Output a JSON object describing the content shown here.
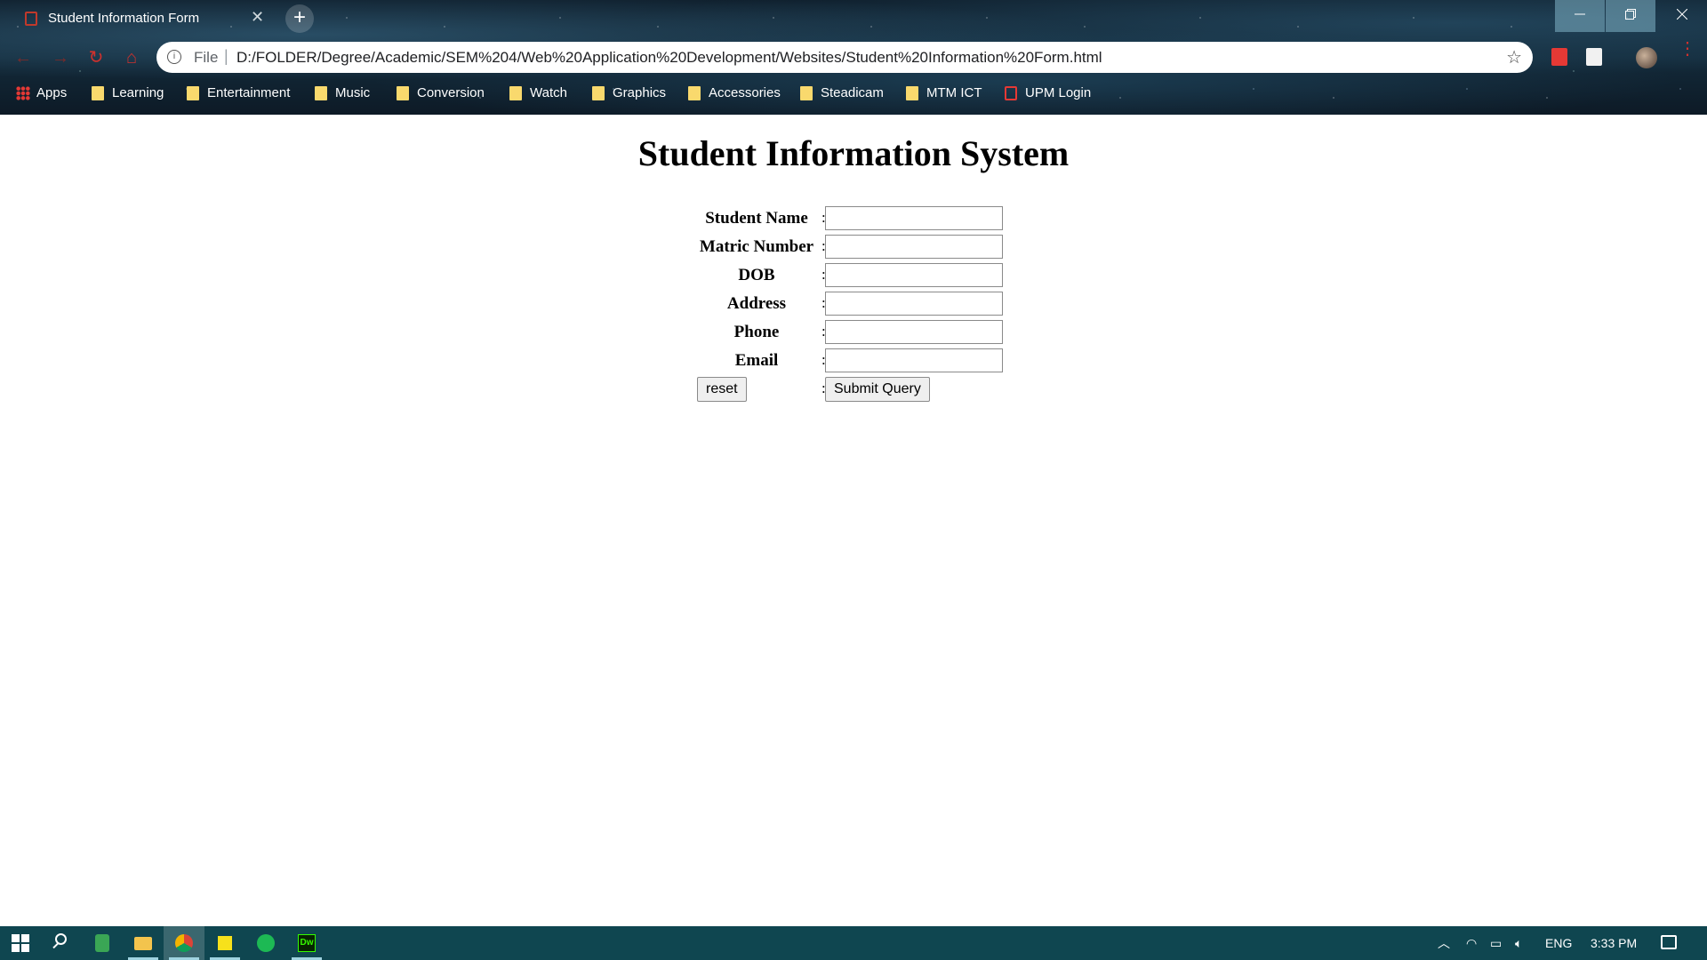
{
  "browser": {
    "tab_title": "Student Information Form",
    "new_tab_symbol": "+",
    "close_tab_symbol": "✕",
    "address_prefix": "File",
    "url": "D:/FOLDER/Degree/Academic/SEM%204/Web%20Application%20Development/Websites/Student%20Information%20Form.html",
    "bookmarks": [
      {
        "label": "Apps",
        "icon": "apps-grid-icon"
      },
      {
        "label": "Learning",
        "icon": "folder-icon"
      },
      {
        "label": "Entertainment",
        "icon": "folder-icon"
      },
      {
        "label": "Music",
        "icon": "folder-icon"
      },
      {
        "label": "Conversion",
        "icon": "folder-icon"
      },
      {
        "label": "Watch",
        "icon": "folder-icon"
      },
      {
        "label": "Graphics",
        "icon": "folder-icon"
      },
      {
        "label": "Accessories",
        "icon": "folder-icon"
      },
      {
        "label": "Steadicam",
        "icon": "folder-icon"
      },
      {
        "label": "MTM ICT",
        "icon": "folder-icon"
      },
      {
        "label": "UPM Login",
        "icon": "pdf-icon"
      }
    ]
  },
  "page": {
    "heading": "Student Information System",
    "fields": [
      {
        "label": "Student Name",
        "value": ""
      },
      {
        "label": "Matric Number",
        "value": ""
      },
      {
        "label": "DOB",
        "value": ""
      },
      {
        "label": "Address",
        "value": ""
      },
      {
        "label": "Phone",
        "value": ""
      },
      {
        "label": "Email",
        "value": ""
      }
    ],
    "separator": ":",
    "reset_label": "reset",
    "submit_label": "Submit Query"
  },
  "taskbar": {
    "apps": [
      "start-icon",
      "search-icon",
      "notepad-icon",
      "file-explorer-icon",
      "chrome-icon",
      "sticky-notes-icon",
      "spotify-icon",
      "dreamweaver-icon"
    ],
    "language": "ENG",
    "time": "3:33 PM"
  },
  "colors": {
    "taskbar": "#0f4650",
    "folder": "#f9d96d",
    "accent_red": "#d0312d"
  }
}
